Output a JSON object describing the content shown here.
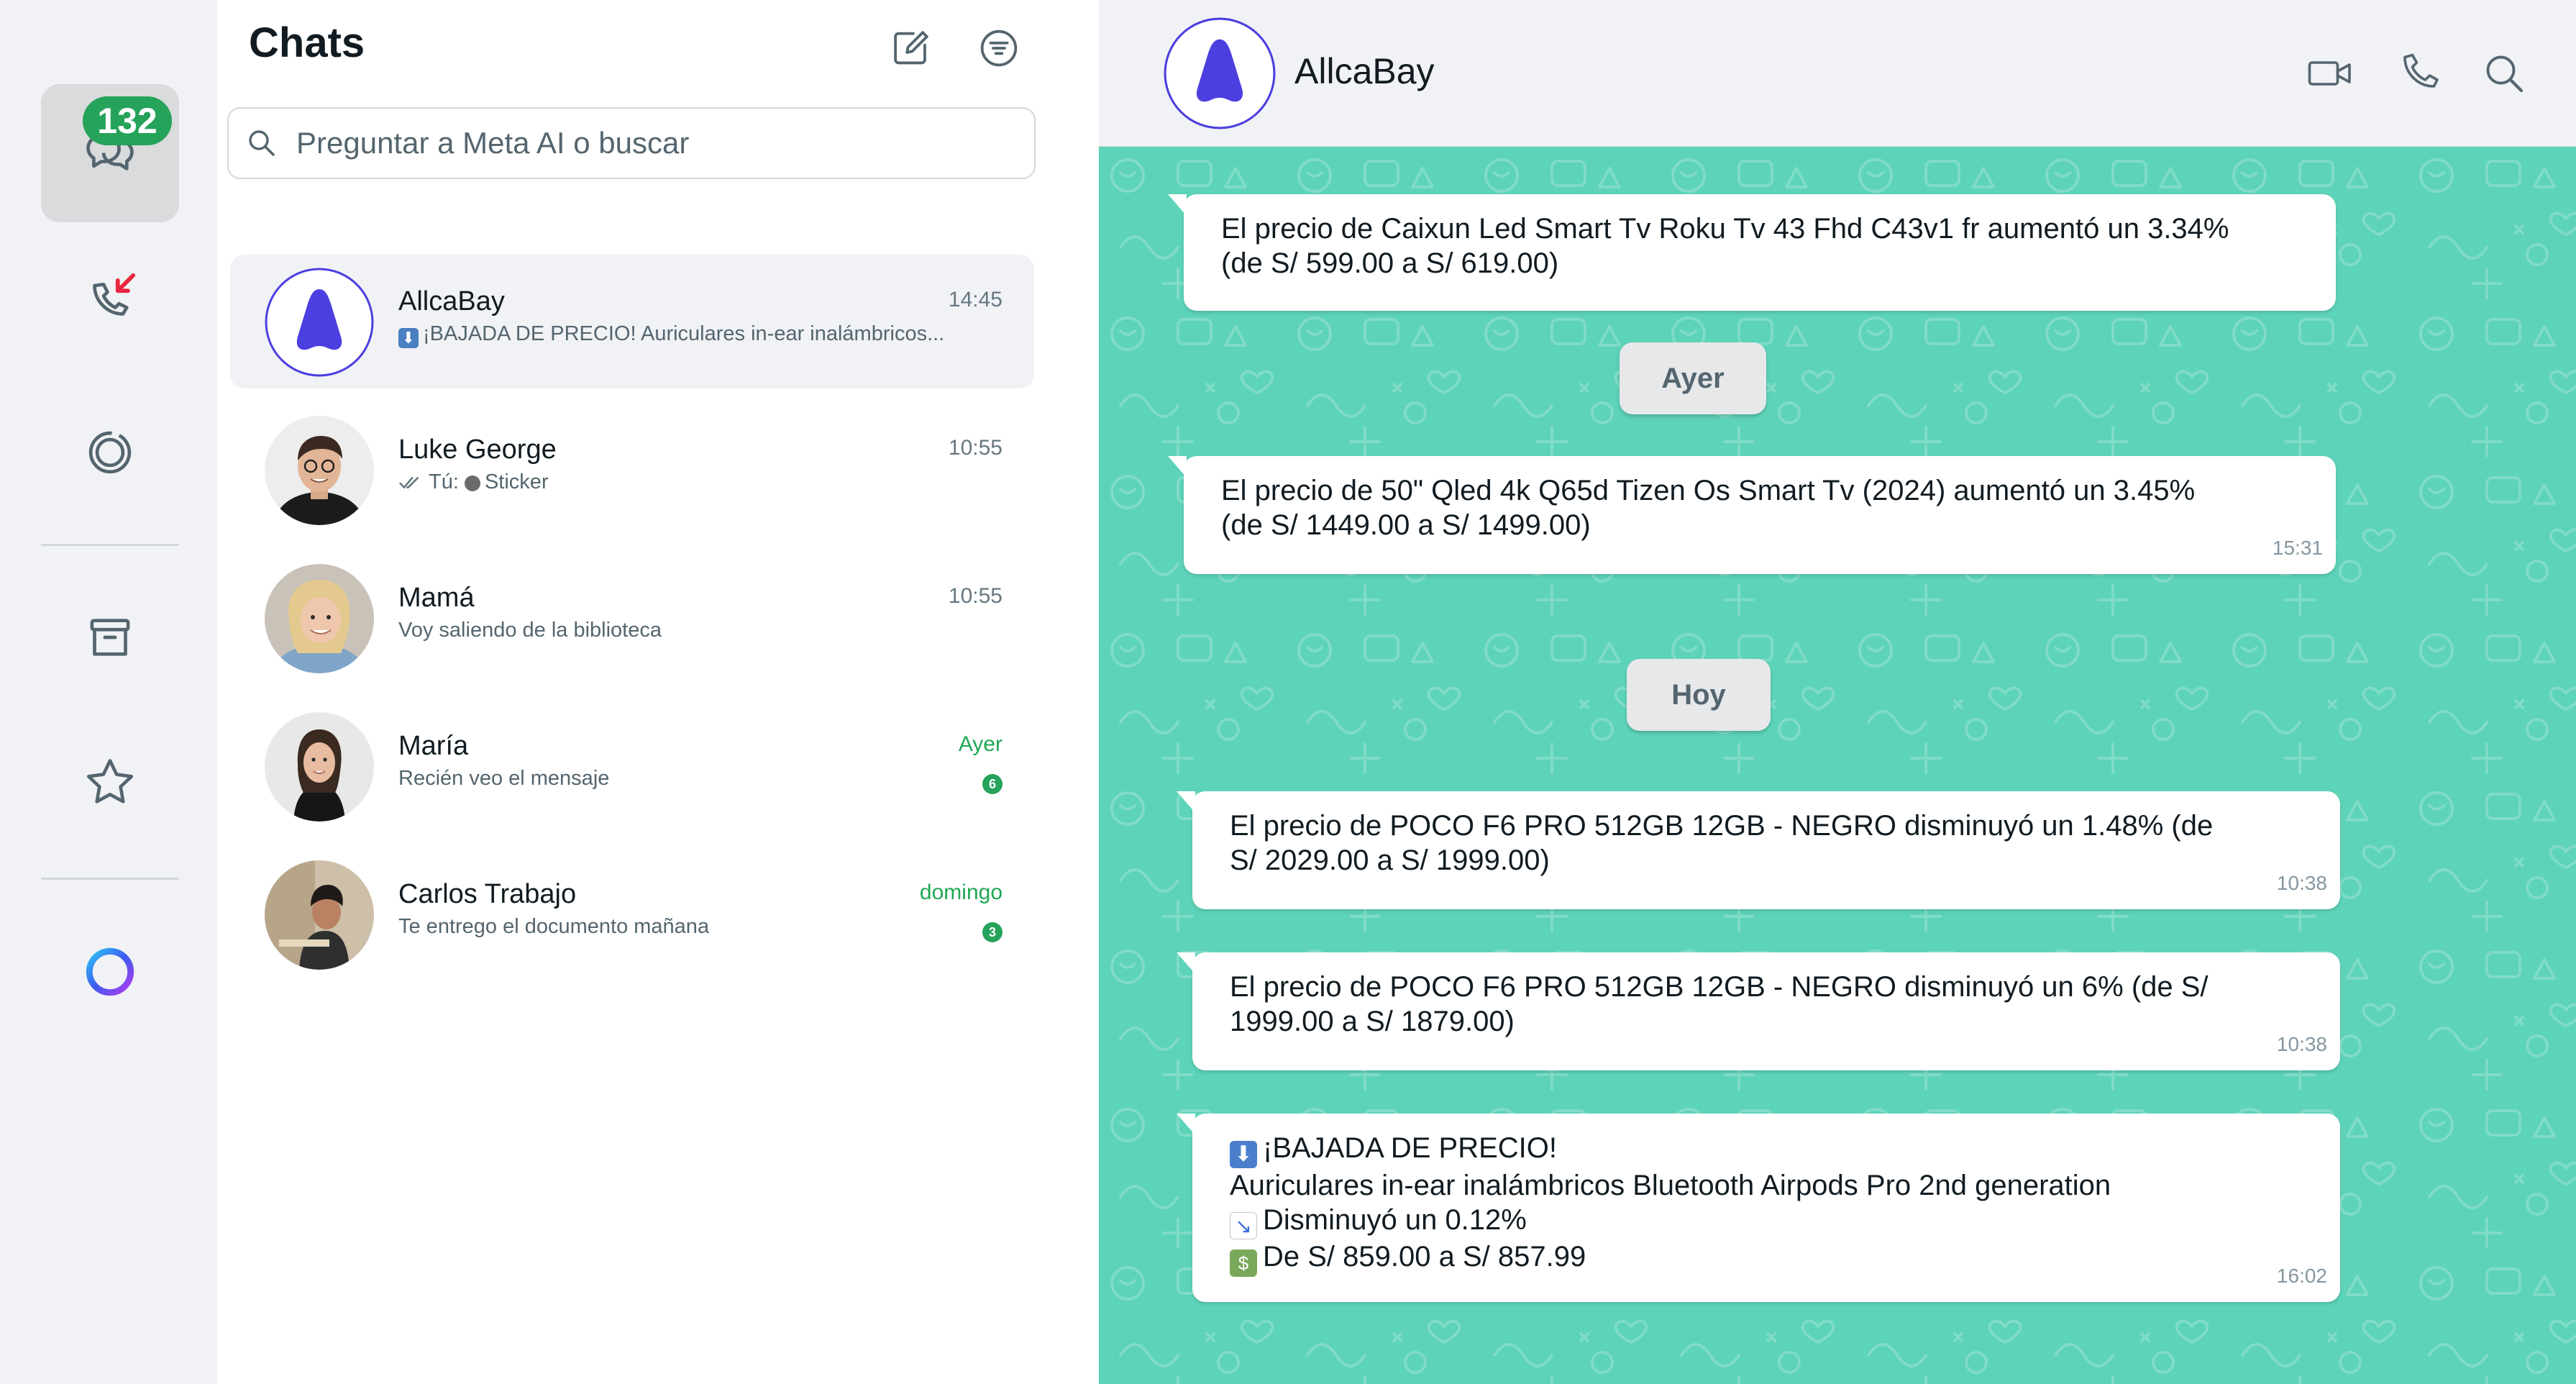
{
  "rail": {
    "chats_badge": "132"
  },
  "chat_list": {
    "title": "Chats",
    "search_placeholder": "Preguntar a Meta AI o buscar",
    "chats": [
      {
        "name": "AllcaBay",
        "time": "14:45",
        "preview": "¡BAJADA DE PRECIO! Auriculares in-ear inalámbricos..."
      },
      {
        "name": "Luke George",
        "time": "10:55",
        "preview_prefix": "Tú:",
        "preview": "Sticker"
      },
      {
        "name": "Mamá",
        "time": "10:55",
        "preview": "Voy saliendo de la biblioteca"
      },
      {
        "name": "María",
        "time": "Ayer",
        "preview": "Recién veo el mensaje",
        "unread": "6"
      },
      {
        "name": "Carlos Trabajo",
        "time": "domingo",
        "preview": "Te entrego el documento mañana",
        "unread": "3"
      }
    ]
  },
  "conversation": {
    "contact_name": "AllcaBay",
    "messages": [
      {
        "line1": "El precio de Caixun Led Smart Tv Roku Tv 43 Fhd C43v1 fr aumentó un 3.34%",
        "line2": "(de S/ 599.00 a S/ 619.00)",
        "time": ""
      },
      {
        "line1": "El precio de 50\" Qled 4k Q65d Tizen Os Smart Tv (2024) aumentó un 3.45%",
        "line2": "(de S/ 1449.00 a S/ 1499.00)",
        "time": "15:31"
      },
      {
        "line1": "El precio de POCO F6 PRO 512GB 12GB - NEGRO disminuyó un 1.48% (de",
        "line2": "S/ 2029.00 a S/ 1999.00)",
        "time": "10:38"
      },
      {
        "line1": "El precio de POCO F6 PRO 512GB 12GB - NEGRO disminuyó un 6% (de S/",
        "line2": "1999.00 a S/ 1879.00)",
        "time": "10:38"
      }
    ],
    "day_chips": [
      "Ayer",
      "Hoy"
    ],
    "last_message": {
      "line1": "¡BAJADA DE PRECIO!",
      "line2": "Auriculares in-ear inalámbricos Bluetooth Airpods Pro 2nd generation",
      "line3": "Disminuyó un 0.12%",
      "line4": "De S/ 859.00 a S/ 857.99",
      "time": "16:02"
    }
  },
  "colors": {
    "accent_green": "#25a35a",
    "wallpaper": "#5dd3b9",
    "brand_purple": "#4b3fe0"
  }
}
